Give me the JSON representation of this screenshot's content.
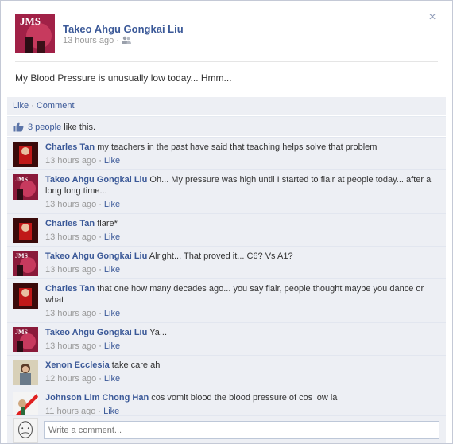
{
  "post": {
    "author": "Takeo Ahgu Gongkai Liu",
    "time": "13 hours ago",
    "privacy_icon": "friends-icon",
    "message": "My Blood Pressure is unusually low today... Hmm..."
  },
  "actions": {
    "like": "Like",
    "separator": "·",
    "comment": "Comment"
  },
  "likes": {
    "count_text": "3 people",
    "suffix": " like this."
  },
  "close_icon": "×",
  "comments": [
    {
      "author": "Charles Tan",
      "text": "my teachers in the past have said that teaching helps solve that problem",
      "time": "13 hours ago",
      "like": "Like",
      "avatar": "red-avatar"
    },
    {
      "author": "Takeo Ahgu Gongkai Liu",
      "text": "Oh... My pressure was high until I started to flair at people today... after a long long time...",
      "time": "13 hours ago",
      "like": "Like",
      "avatar": "magenta-avatar"
    },
    {
      "author": "Charles Tan",
      "text": "flare*",
      "time": "13 hours ago",
      "like": "Like",
      "avatar": "red-avatar"
    },
    {
      "author": "Takeo Ahgu Gongkai Liu",
      "text": "Alright... That proved it... C6? Vs A1?",
      "time": "13 hours ago",
      "like": "Like",
      "avatar": "magenta-avatar"
    },
    {
      "author": "Charles Tan",
      "text": "that one how many decades ago... you say flair, people thought maybe you dance or what",
      "time": "13 hours ago",
      "like": "Like",
      "avatar": "red-avatar"
    },
    {
      "author": "Takeo Ahgu Gongkai Liu",
      "text": "Ya...",
      "time": "13 hours ago",
      "like": "Like",
      "avatar": "magenta-avatar"
    },
    {
      "author": "Xenon Ecclesia",
      "text": "take care ah",
      "time": "12 hours ago",
      "like": "Like",
      "avatar": "photo-avatar"
    },
    {
      "author": "Johnson Lim Chong Han",
      "text": "cos vomit blood the blood pressure of cos low la",
      "time": "11 hours ago",
      "like": "Like",
      "avatar": "flag-avatar"
    }
  ],
  "write_comment": {
    "placeholder": "Write a comment..."
  },
  "colors": {
    "link": "#3b5998",
    "panel": "#edeff4",
    "meta": "#999999"
  }
}
